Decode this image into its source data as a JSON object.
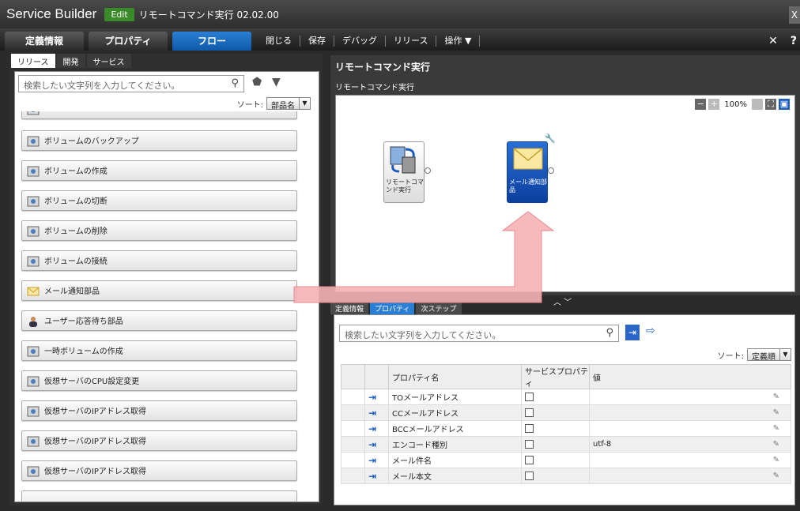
{
  "titlebar": {
    "app_title": "Service Builder",
    "mode": "Edit",
    "service": "リモートコマンド実行 02.02.00",
    "close": "X"
  },
  "menubar": {
    "tabs": [
      "定義情報",
      "プロパティ",
      "フロー"
    ],
    "active_tab": "フロー",
    "items": [
      "閉じる",
      "保存",
      "デバッグ",
      "リリース",
      "操作 ▼"
    ],
    "right": [
      "✕",
      "?"
    ]
  },
  "left_panel": {
    "tabs": [
      "リリース",
      "開発",
      "サービス"
    ],
    "search_placeholder": "検索したい文字列を入力してください。",
    "sort_label": "ソート:",
    "sort_value": "部品名",
    "parts": [
      "ボリュームのバックアップ",
      "ボリュームの作成",
      "ボリュームの切断",
      "ボリュームの削除",
      "ボリュームの接続",
      "メール通知部品",
      "ユーザー応答待ち部品",
      "一時ボリュームの作成",
      "仮想サーバのCPU設定変更",
      "仮想サーバのIPアドレス取得",
      "仮想サーバのIPアドレス取得",
      "仮想サーバのIPアドレス取得"
    ]
  },
  "flow": {
    "title": "リモートコマンド実行",
    "subtitle": "リモートコマンド実行",
    "zoom": "100%",
    "nodes": [
      {
        "label": "リモートコマンド実行"
      },
      {
        "label": "メール通知部品"
      }
    ]
  },
  "bottom": {
    "tabs": [
      "定義情報",
      "プロパティ",
      "次ステップ"
    ],
    "active_tab": "プロパティ",
    "search_placeholder": "検索したい文字列を入力してください。",
    "sort_label": "ソート:",
    "sort_value": "定義順",
    "columns": [
      "プロパティ名",
      "サービスプロパティ",
      "値"
    ],
    "rows": [
      {
        "name": "TOメールアドレス",
        "value": ""
      },
      {
        "name": "CCメールアドレス",
        "value": ""
      },
      {
        "name": "BCCメールアドレス",
        "value": ""
      },
      {
        "name": "エンコード種別",
        "value": "utf-8"
      },
      {
        "name": "メール件名",
        "value": ""
      },
      {
        "name": "メール本文",
        "value": ""
      }
    ]
  },
  "colors": {
    "accent": "#2a7fd4",
    "arrow": "#f2a3a6"
  }
}
